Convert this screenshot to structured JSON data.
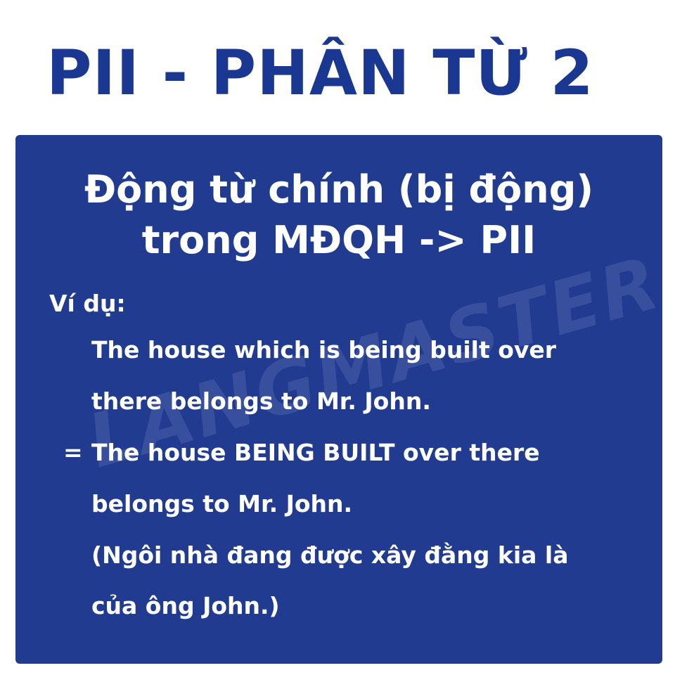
{
  "title": "PII - PHÂN TỪ 2",
  "card": {
    "heading_line1": "Động từ chính (bị động)",
    "heading_line2": "trong MĐQH -> PII",
    "example_label": "Ví dụ:",
    "equals": "=",
    "lines": [
      "The house which is being built over",
      "there belongs to Mr. John.",
      "The house BEING BUILT over there",
      "belongs to Mr. John.",
      "(Ngôi nhà đang được xây đằng kia là",
      "của ông John.)"
    ],
    "watermark": "LANGMASTER"
  },
  "colors": {
    "title": "#1a3891",
    "card_background": "#213b91",
    "text": "#ffffff"
  }
}
